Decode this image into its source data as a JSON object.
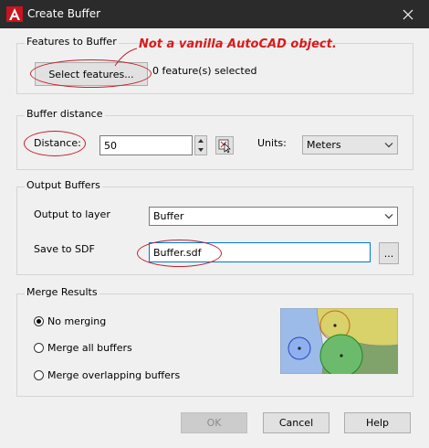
{
  "window": {
    "title": "Create Buffer"
  },
  "features": {
    "group_label": "Features to Buffer",
    "select_button": "Select features...",
    "count_text": "0 feature(s) selected"
  },
  "annotation": {
    "text": "Not a vanilla AutoCAD object."
  },
  "distance": {
    "group_label": "Buffer distance",
    "label": "Distance:",
    "value": "50",
    "units_label": "Units:",
    "units_value": "Meters"
  },
  "output": {
    "group_label": "Output Buffers",
    "layer_label": "Output to layer",
    "layer_value": "Buffer",
    "sdf_label": "Save to SDF",
    "sdf_value": "Buffer.sdf",
    "browse_label": "..."
  },
  "merge": {
    "group_label": "Merge Results",
    "options": [
      "No merging",
      "Merge all buffers",
      "Merge overlapping buffers"
    ],
    "selected": 0
  },
  "buttons": {
    "ok": "OK",
    "cancel": "Cancel",
    "help": "Help"
  },
  "preview_colors": {
    "blue": "#9cbbe8",
    "yellow": "#d9d16a",
    "green": "#6cbb6c",
    "background": "#e4e7f8"
  }
}
